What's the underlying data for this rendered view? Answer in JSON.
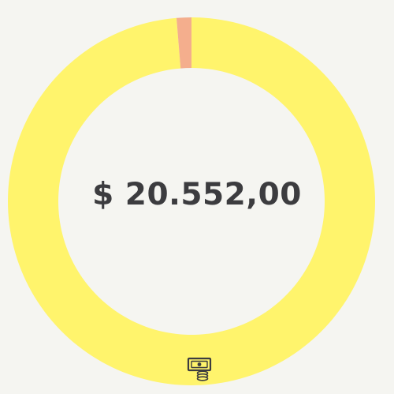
{
  "widget": {
    "total_label": "$ 20.552,00",
    "footer_icon": "cash-coins-icon"
  },
  "colors": {
    "background": "#f5f5f1",
    "text": "#3c3c3f",
    "primary_segment": "#fff46c",
    "secondary_segment": "#f4ae8d"
  },
  "chart_data": {
    "type": "pie",
    "style": "donut",
    "title": "",
    "slices": [
      {
        "label": "",
        "share": 0.987,
        "color": "#fff46c"
      },
      {
        "label": "",
        "share": 0.013,
        "color": "#f4ae8d"
      }
    ]
  }
}
